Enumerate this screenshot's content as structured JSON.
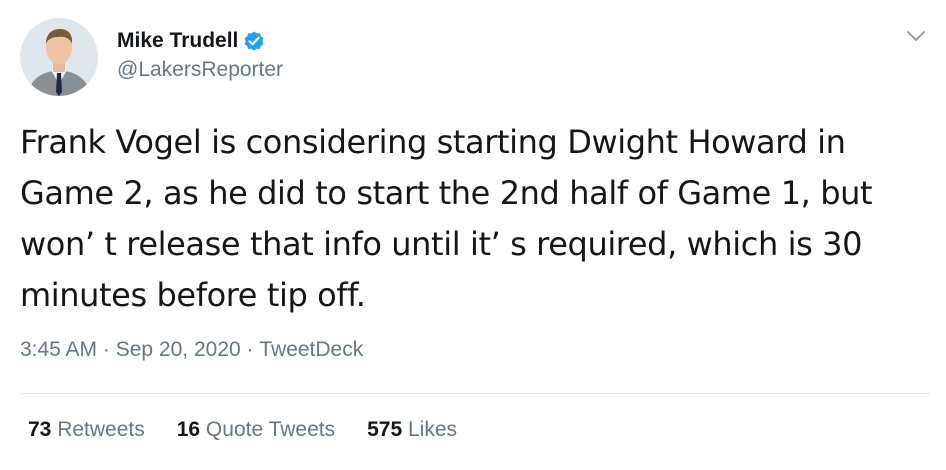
{
  "colors": {
    "text": "#14171a",
    "secondary": "#657786",
    "verified": "#1da1f2",
    "divider": "#e1e8ed"
  },
  "author": {
    "display_name": "Mike Trudell",
    "handle": "@LakersReporter",
    "verified": true,
    "avatar_icon": "profile-photo"
  },
  "tweet": {
    "text": "Frank Vogel is considering starting Dwight Howard in Game 2, as he did to start the 2nd half of Game 1, but won’ t release that info until it’ s required, which is 30 minutes before tip off.",
    "time": "3:45 AM",
    "date": "Sep 20, 2020",
    "source": "TweetDeck",
    "separator": " · "
  },
  "stats": {
    "retweets_count": "73",
    "retweets_label": " Retweets",
    "quote_count": "16",
    "quote_label": " Quote Tweets",
    "likes_count": "575",
    "likes_label": " Likes"
  },
  "menu": {
    "icon": "chevron-down-icon"
  }
}
